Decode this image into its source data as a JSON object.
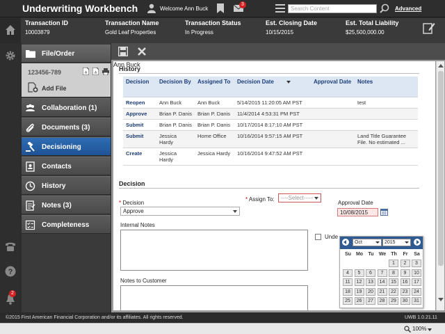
{
  "app": {
    "title": "Underwriting Workbench",
    "welcome": "Welcome Ann Buck",
    "mail_badge": "3",
    "search_placeholder": "Search Content",
    "advanced": "Advanced",
    "notification_badge": "2"
  },
  "transaction": [
    {
      "label": "Transaction ID",
      "value": "10003879"
    },
    {
      "label": "Transaction Name",
      "value": "Gold Leaf Properties"
    },
    {
      "label": "Transaction Status",
      "value": "In Progress"
    },
    {
      "label": "Est. Closing Date",
      "value": "10/15/2015"
    },
    {
      "label": "Est. Total Liability",
      "value": "$25,500,000.00"
    }
  ],
  "nav": {
    "file_order": "File/Order",
    "file_number": "123456-789",
    "add_file": "Add File",
    "items": [
      {
        "label": "Collaboration (1)"
      },
      {
        "label": "Documents (3)"
      },
      {
        "label": "Decisioning"
      },
      {
        "label": "Contacts"
      },
      {
        "label": "History"
      },
      {
        "label": "Notes (3)"
      },
      {
        "label": "Completeness"
      }
    ]
  },
  "history": {
    "title": "History",
    "columns": [
      "Decision",
      "Decision By",
      "Assigned To",
      "Decision Date",
      "Approval Date",
      "Notes"
    ],
    "rows": [
      {
        "decision": "Reopen",
        "by": "Ann Buck",
        "to": "Ann Buck",
        "date": "5/14/2015 11:20:05 AM PST",
        "approval": "",
        "notes": "test"
      },
      {
        "decision": "Approve",
        "by": "Brian P. Danis",
        "to": "Brian P. Danis",
        "date": "11/4/2014 4:53:31 PM PST",
        "approval": "",
        "notes": ""
      },
      {
        "decision": "Submit",
        "by": "Brian P. Danis",
        "to": "Brian P. Danis",
        "date": "10/17/2014 8:17:10 AM PST",
        "approval": "",
        "notes": ""
      },
      {
        "decision": "Submit",
        "by": "Jessica Hardy",
        "to": "Home Office",
        "date": "10/16/2014 9:57:15 AM PST",
        "approval": "",
        "notes": "Land Title Guarantee File. No estimated ..."
      },
      {
        "decision": "Create",
        "by": "Jessica Hardy",
        "to": "Jessica Hardy",
        "date": "10/16/2014 9:47:52 AM PST",
        "approval": "",
        "notes": ""
      }
    ]
  },
  "decision": {
    "title": "Decision",
    "decision_label": "Decision",
    "decision_value": "Approve",
    "assign_label": "Assign To:",
    "assign_select": "----Select-----",
    "assign_value": "Ann Buck",
    "approval_label": "Approval Date",
    "approval_value": "10/08/2015",
    "internal_notes_label": "Internal Notes",
    "notes_customer_label": "Notes to Customer",
    "checkbox_label": "Unde"
  },
  "calendar": {
    "month": "Oct",
    "year": "2015",
    "dow": [
      "Su",
      "Mo",
      "Tu",
      "We",
      "Th",
      "Fr",
      "Sa"
    ],
    "weeks": [
      [
        "",
        "",
        "",
        "",
        "1",
        "2",
        "3"
      ],
      [
        "4",
        "5",
        "6",
        "7",
        "8",
        "9",
        "10"
      ],
      [
        "11",
        "12",
        "13",
        "14",
        "15",
        "16",
        "17"
      ],
      [
        "18",
        "19",
        "20",
        "21",
        "22",
        "23",
        "24"
      ],
      [
        "25",
        "26",
        "27",
        "28",
        "29",
        "30",
        "31"
      ]
    ]
  },
  "footer": {
    "copyright": "©2015 First American Financial Corporation and/or its affiliates. All rights reserved.",
    "version": "UWB 1.0.21.11",
    "zoom": "100%"
  },
  "colors": {
    "accent": "#1e5394",
    "header": "#2e2e2e",
    "badge": "#d42020"
  }
}
